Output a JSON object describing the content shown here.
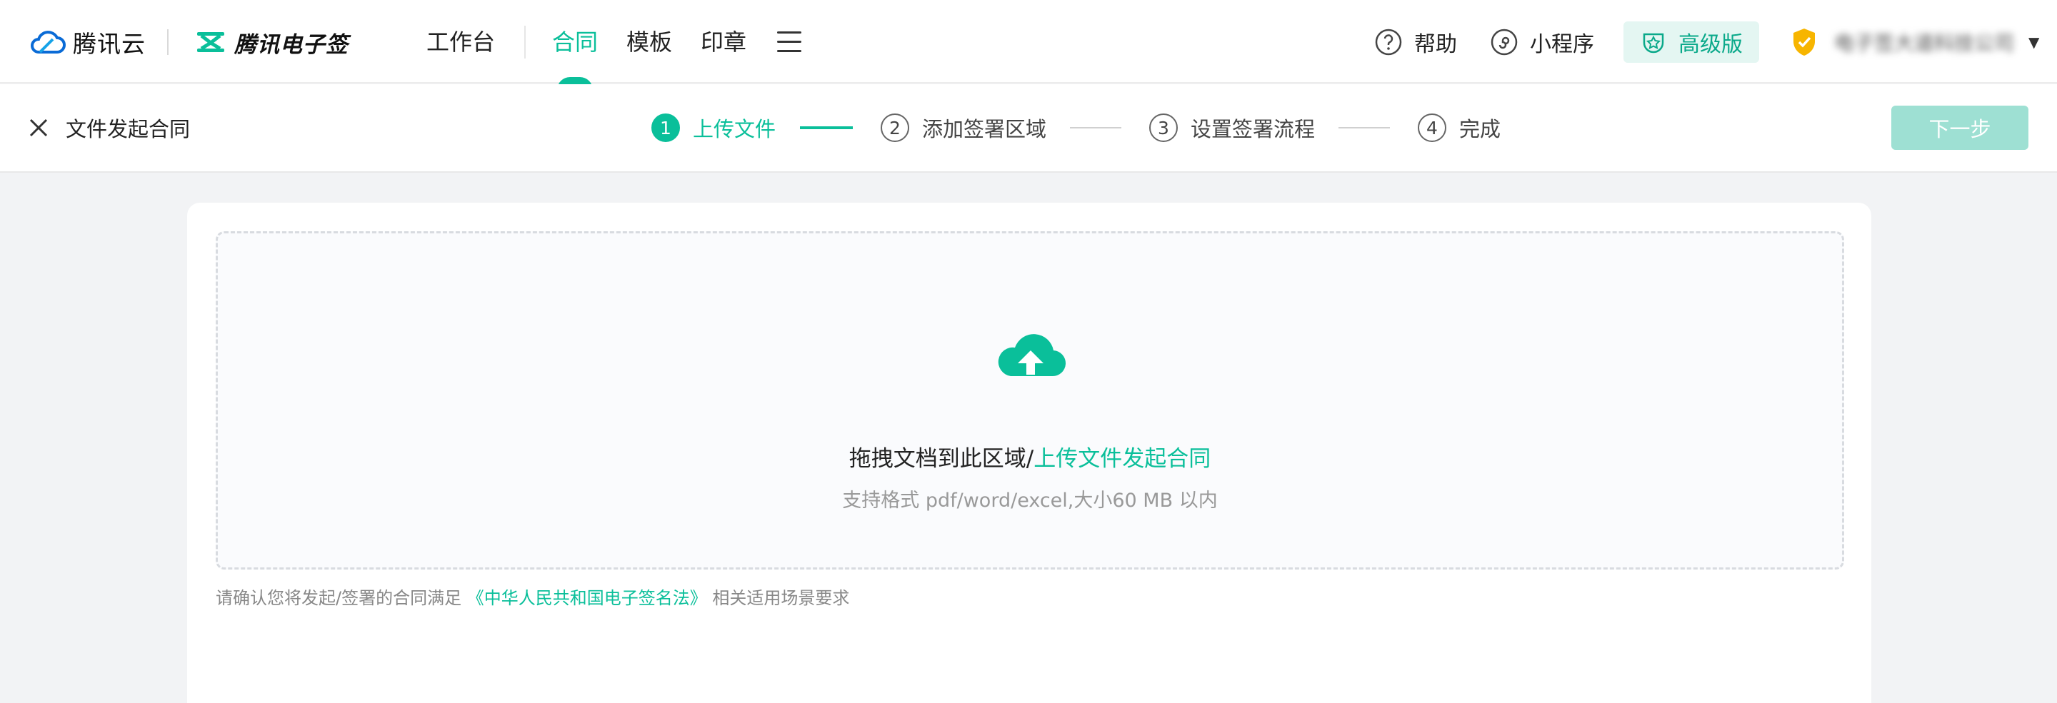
{
  "brand": {
    "name": "腾讯云"
  },
  "esign": {
    "name": "腾讯电子签"
  },
  "nav": {
    "workbench": "工作台",
    "contract": "合同",
    "template": "模板",
    "seal": "印章"
  },
  "tools": {
    "help": "帮助",
    "miniprogram": "小程序",
    "premium": "高级版"
  },
  "account": {
    "org_name": "电子签大道科技公司"
  },
  "stepbar": {
    "close_label": "文件发起合同",
    "steps": [
      {
        "num": "1",
        "label": "上传文件"
      },
      {
        "num": "2",
        "label": "添加签署区域"
      },
      {
        "num": "3",
        "label": "设置签署流程"
      },
      {
        "num": "4",
        "label": "完成"
      }
    ],
    "next_label": "下一步"
  },
  "upload": {
    "main_text": "拖拽文档到此区域/",
    "link_text": "上传文件发起合同",
    "hint": "支持格式 pdf/word/excel,大小60 MB 以内"
  },
  "notice": {
    "before": "请确认您将发起/签署的合同满足 ",
    "law": "《中华人民共和国电子签名法》",
    "after": " 相关适用场景要求"
  },
  "colors": {
    "accent": "#0abf9a",
    "accent_light": "#9ee0d3",
    "premium_bg": "#e4f6f2"
  }
}
